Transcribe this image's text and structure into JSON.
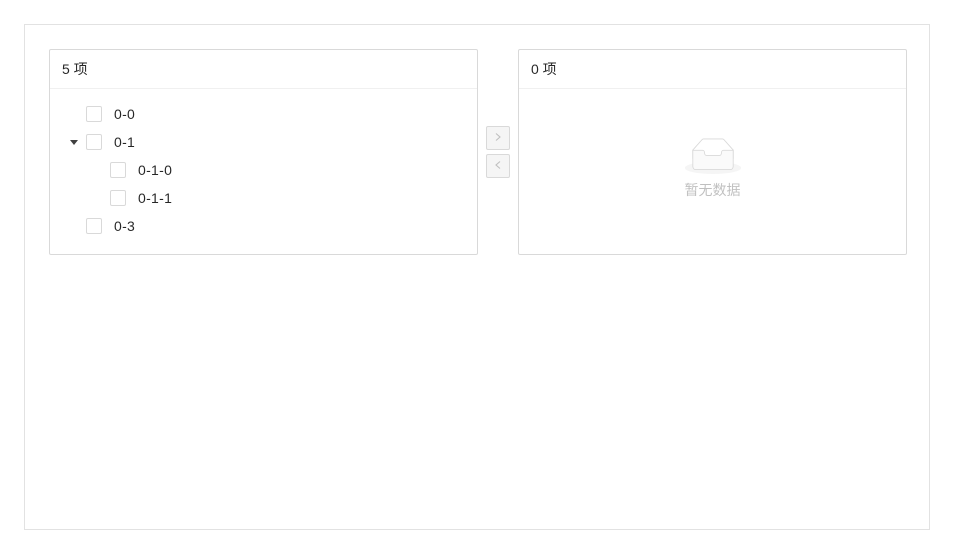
{
  "left_panel": {
    "count_label": "5 项",
    "tree": [
      {
        "title": "0-0"
      },
      {
        "title": "0-1",
        "expanded": true
      },
      {
        "title": "0-1-0"
      },
      {
        "title": "0-1-1"
      },
      {
        "title": "0-3"
      }
    ]
  },
  "operations": {
    "move_right_icon": "chevron-right-icon",
    "move_left_icon": "chevron-left-icon"
  },
  "right_panel": {
    "count_label": "0 项",
    "empty_text": "暂无数据",
    "empty_icon": "empty-inbox-icon"
  },
  "colors": {
    "border": "#d9d9d9",
    "frame_border": "#e2e2e2",
    "disabled_bg": "#f5f5f5",
    "muted_text": "#bfbfbf"
  }
}
